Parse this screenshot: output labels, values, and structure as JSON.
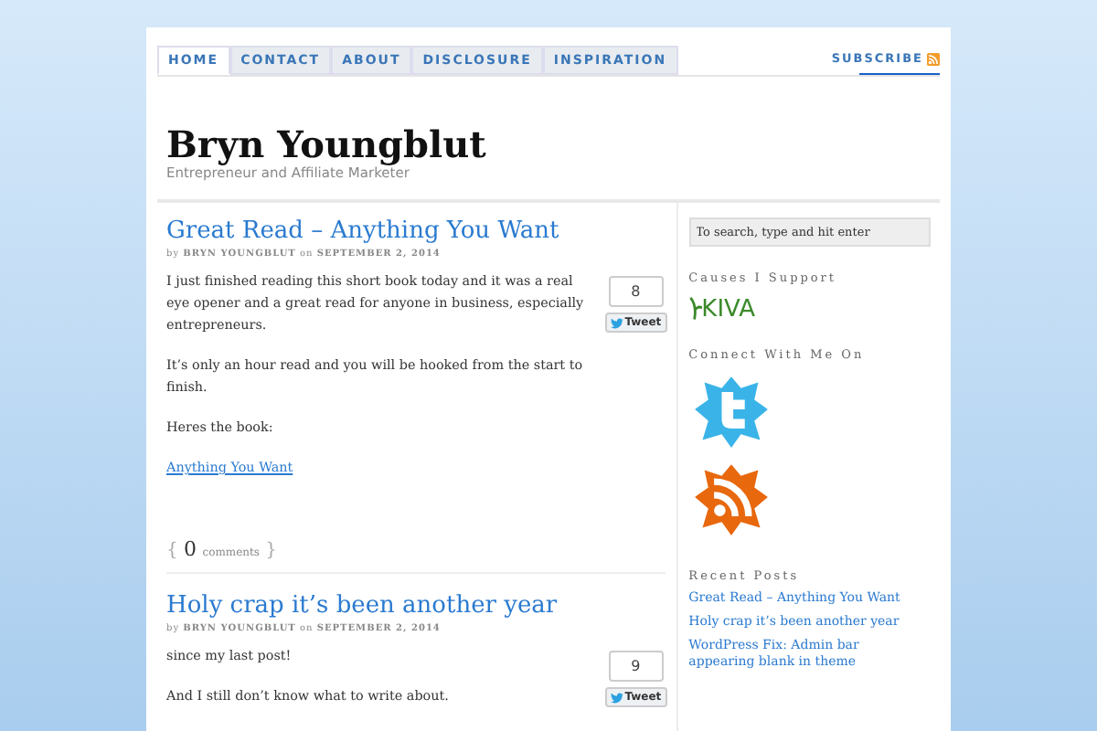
{
  "nav": {
    "tabs": [
      {
        "label": "HOME",
        "selected": true
      },
      {
        "label": "CONTACT",
        "selected": false
      },
      {
        "label": "ABOUT",
        "selected": false
      },
      {
        "label": "DISCLOSURE",
        "selected": false
      },
      {
        "label": "INSPIRATION",
        "selected": false
      }
    ],
    "subscribe": "SUBSCRIBE"
  },
  "header": {
    "title": "Bryn Youngblut",
    "tagline": "Entrepreneur and Affiliate Marketer"
  },
  "posts": [
    {
      "title": "Great Read – Anything You Want",
      "by": "by",
      "author": "BRYN YOUNGBLUT",
      "on": "on",
      "date": "SEPTEMBER 2, 2014",
      "tweet_count": "8",
      "tweet": "Tweet",
      "paragraphs": [
        {
          "kind": "text",
          "text": "I just finished reading this short book today and it was a real eye opener and a great read for anyone in business, especially entrepreneurs."
        },
        {
          "kind": "text",
          "text": "It’s only an hour read and you will be hooked from the start to finish."
        },
        {
          "kind": "text",
          "text": "Heres the book:"
        },
        {
          "kind": "link",
          "text": "Anything You Want"
        }
      ],
      "comments": {
        "open": "{",
        "count": "0",
        "label": "comments",
        "close": "}"
      }
    },
    {
      "title": "Holy crap it’s been another year",
      "by": "by",
      "author": "BRYN YOUNGBLUT",
      "on": "on",
      "date": "SEPTEMBER 2, 2014",
      "tweet_count": "9",
      "tweet": "Tweet",
      "paragraphs": [
        {
          "kind": "text",
          "text": "since my last post!"
        },
        {
          "kind": "text",
          "text": "And I still don’t know what to write about."
        }
      ]
    }
  ],
  "sidebar": {
    "search": {
      "placeholder": "To search, type and hit enter"
    },
    "causes_heading": "Causes I Support",
    "kiva": "KIVA",
    "connect_heading": "Connect With Me On",
    "recent_heading": "Recent Posts",
    "recent": [
      "Great Read – Anything You Want",
      "Holy crap it’s been another year",
      "WordPress Fix: Admin bar appearing blank in theme"
    ]
  }
}
